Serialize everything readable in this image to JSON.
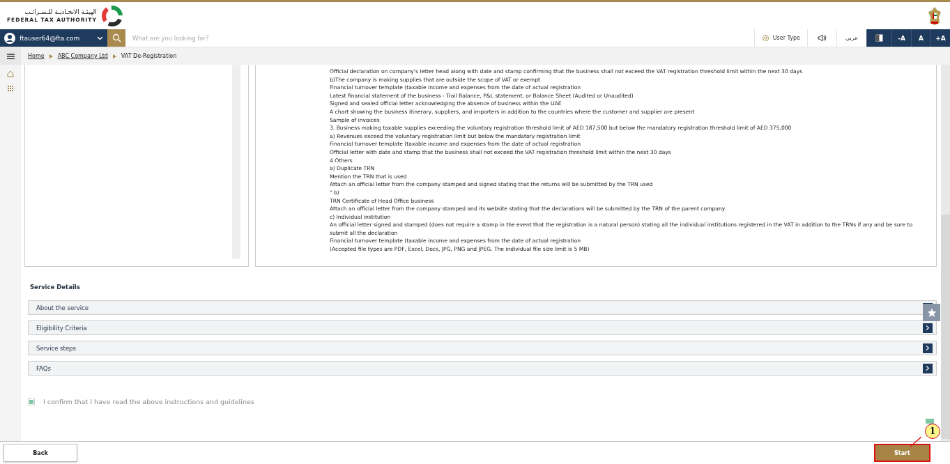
{
  "header": {
    "logo_arabic": "الهيئـة الاتحـاديـة للـضـرائـب",
    "logo_english": "FEDERAL TAX AUTHORITY"
  },
  "navbar": {
    "user": "ftauser64@fta.com",
    "search": {
      "placeholder": "What are you looking for?"
    },
    "user_type": "User Type",
    "language": "عربي",
    "font_buttons": [
      "-A",
      "A",
      "+A"
    ]
  },
  "breadcrumb": [
    "Home",
    "ABC Company Ltd",
    "VAT De-Registration"
  ],
  "instructions": [
    "Official declaration on company's letter head along with date and stamp confirming that the business shall not exceed the VAT registration threshold limit within the next 30 days",
    "b)The company is making supplies that are outside the scope of VAT or exempt",
    "Financial turnover template (taxable income and expenses from the date of actual registration",
    "Latest financial statement of the business - Trail Balance, P&L statement, or Balance Sheet (Audited or Unaudited)",
    "Signed and sealed official letter acknowledging the absence of business within the UAE",
    "A chart showing the business itinerary, suppliers, and importers in addition to the countries where the customer and supplier are present",
    "Sample of invoices",
    "3. Business making taxable supplies exceeding the voluntary registration threshold limit of AED 187,500 but below the mandatory registration threshold limit of AED 375,000",
    "a) Revenues exceed the voluntary registration limit but below the mandatory registration limit",
    "Financial turnover template (taxable income and expenses from the date of actual registration",
    "Official letter with date and stamp that the business shall not exceed the VAT registration threshold limit within the next 30 days",
    "4 Others",
    "a) Duplicate TRN",
    "Mention the TRN that is used",
    "Attach an official letter from the company stamped and signed stating that the returns will be submitted by the TRN used",
    "\"  b)",
    "TRN Certificate of Head Office business",
    "Attach an official letter from the company stamped and its website stating that the declarations will be submitted by the TRN of the parent company",
    "c) Individual institution",
    "An official letter signed and stamped (does not require a stamp in the event that the registration is a natural person) stating all the individual institutions registered in the VAT in addition to the TRNs if any and be sure to submit all the declaration",
    "Financial turnover template (taxable income and expenses from the date of actual registration",
    "(Accepted file types are PDF, Excel, Docs, JPG, PNG and JPEG. The individual file size limit is 5 MB)"
  ],
  "service_details": {
    "title": "Service Details",
    "sections": [
      {
        "label": "About the service",
        "expanded": false
      },
      {
        "label": "Eligibility Criteria",
        "expanded": false
      },
      {
        "label": "Service steps",
        "expanded": false
      },
      {
        "label": "FAQs",
        "expanded": false
      }
    ]
  },
  "confirm": {
    "label": "I confirm that I have read the above instructions and guidelines",
    "checked": true
  },
  "footer": {
    "back": "Back",
    "start": "Start"
  },
  "callout": "1"
}
